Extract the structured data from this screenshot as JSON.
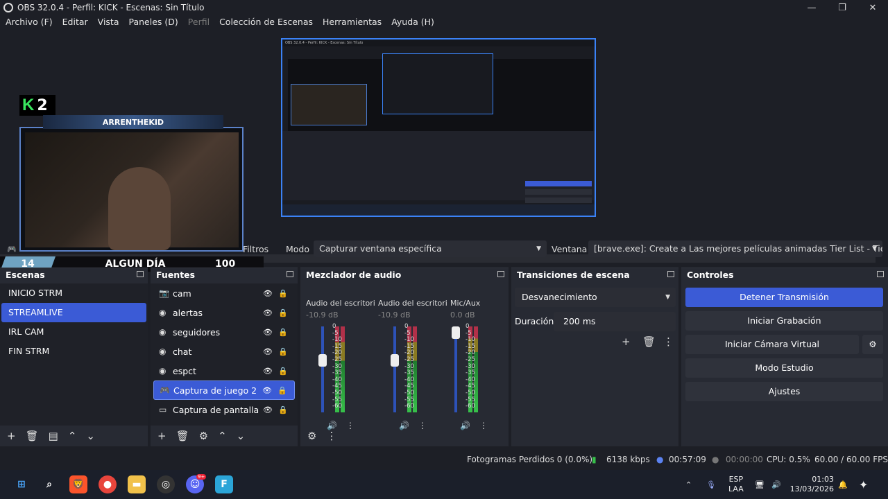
{
  "window": {
    "title": "OBS 32.0.4 - Perfil: KICK - Escenas: Sin Título",
    "minimize": "—",
    "maximize": "❐",
    "close": "✕"
  },
  "menu": [
    "Archivo (F)",
    "Editar",
    "Vista",
    "Paneles (D)",
    "Perfil",
    "Colección de Escenas",
    "Herramientas",
    "Ayuda (H)"
  ],
  "preview": {
    "badge": "2",
    "badge_letter": "K",
    "banner_name": "ARRENTHEKID",
    "level": "14",
    "player_name": "ALGUN DÍA",
    "score": "100",
    "nested_title": "OBS 32.0.4 - Perfil: KICK - Escenas: Sin Título"
  },
  "props": {
    "filters": "Filtros",
    "mode_label": "Modo",
    "mode_value": "Capturar ventana específica",
    "window_label": "Ventana",
    "window_value": "[brave.exe]: Create a Las mejores películas animadas Tier List - TierMa"
  },
  "scenes": {
    "title": "Escenas",
    "items": [
      "INICIO STRM",
      "STREAMLIVE",
      "IRL CAM",
      "FIN STRM"
    ],
    "active": 1
  },
  "sources": {
    "title": "Fuentes",
    "items": [
      "cam",
      "alertas",
      "seguidores",
      "chat",
      "espct",
      "Captura de juego 2",
      "Captura de pantalla"
    ],
    "active": 5
  },
  "mixer": {
    "title": "Mezclador de audio",
    "channels": [
      {
        "name": "Audio del escritorio",
        "db": "-10.9 dB",
        "level": 0.62
      },
      {
        "name": "Audio del escritorio",
        "db": "-10.9 dB",
        "level": 0.62
      },
      {
        "name": "Mic/Aux",
        "db": "0.0 dB",
        "level": 0.9
      }
    ],
    "ticks": [
      "0",
      "-5",
      "-10",
      "-15",
      "-20",
      "-25",
      "-30",
      "-35",
      "-40",
      "-45",
      "-50",
      "-55",
      "-60"
    ]
  },
  "transitions": {
    "title": "Transiciones de escena",
    "type": "Desvanecimiento",
    "duration_label": "Duración",
    "duration": "200 ms"
  },
  "controls": {
    "title": "Controles",
    "buttons": [
      "Detener Transmisión",
      "Iniciar Grabación",
      "Iniciar Cámara Virtual",
      "Modo Estudio",
      "Ajustes"
    ]
  },
  "status": {
    "dropped": "Fotogramas Perdidos 0 (0.0%)",
    "bitrate": "6138 kbps",
    "stream_time": "00:57:09",
    "rec_time": "00:00:00",
    "cpu": "CPU: 0.5%",
    "fps": "60.00 / 60.00 FPS"
  },
  "taskbar": {
    "lang": "ESP",
    "region": "LAA",
    "time": "01:03",
    "date": "13/03/2026",
    "discord_badge": "9+"
  },
  "colors": {
    "accent": "#3b5bd6",
    "kick_green": "#39e75f",
    "bg": "#1d1f26",
    "dock": "#272a33"
  }
}
